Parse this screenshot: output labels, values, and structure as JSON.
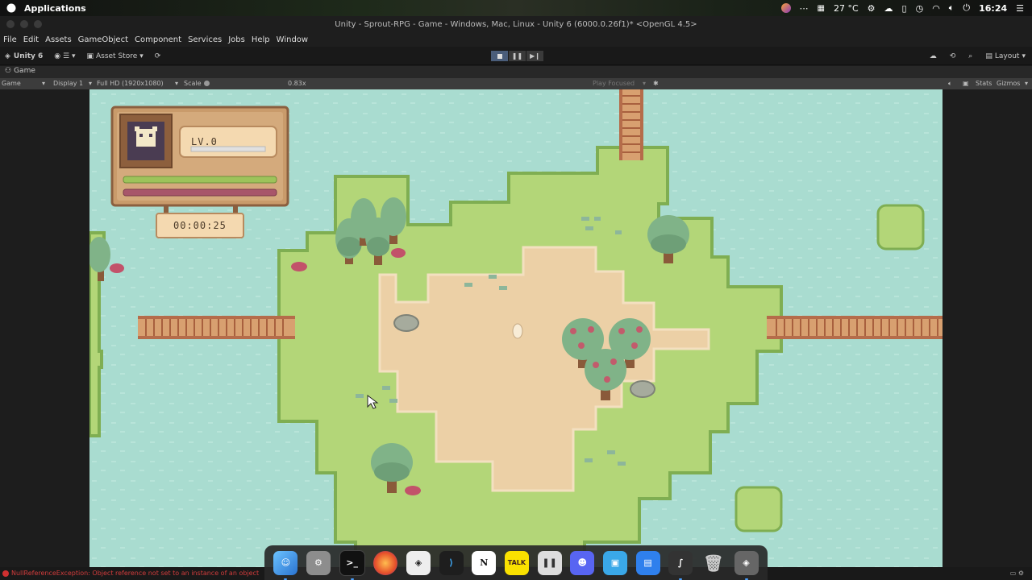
{
  "os_bar": {
    "applications_label": "Applications",
    "temperature": "27 °C",
    "clock": "16:24"
  },
  "window": {
    "title": "Unity - Sprout-RPG - Game - Windows, Mac, Linux - Unity 6 (6000.0.26f1)* <OpenGL 4.5>"
  },
  "menu": [
    "File",
    "Edit",
    "Assets",
    "GameObject",
    "Component",
    "Services",
    "Jobs",
    "Help",
    "Window"
  ],
  "toolbar": {
    "account_label": "Unity 6",
    "asset_store_label": "Asset Store",
    "layout_label": "Layout"
  },
  "game_tab": {
    "label": "Game"
  },
  "game_controls": {
    "view_select": "Game",
    "display_select": "Display 1",
    "resolution_select": "Full HD (1920x1080)",
    "scale_label": "Scale",
    "scale_value": "0.83x",
    "play_mode_select": "Play Focused",
    "stats_label": "Stats",
    "gizmos_label": "Gizmos"
  },
  "hud": {
    "level_text": "LV.0",
    "timer_text": "00:00:25",
    "xp_progress": 0,
    "stamina_progress": 1.0,
    "health_progress": 1.0
  },
  "status_bar": {
    "message": "NullReferenceException: Object reference not set to an instance of an object"
  },
  "dock": {
    "apps": [
      "Finder",
      "System Settings",
      "Terminal",
      "Firefox",
      "Unity Hub",
      "Visual Studio Code",
      "Notion",
      "KakaoTalk",
      "Pixel",
      "Discord",
      "Preview",
      "Files",
      "Figma",
      "Trash",
      "Unity"
    ]
  },
  "colors": {
    "water": "#a9dcd0",
    "grass": "#b3d678",
    "dirt": "#ecd0a6",
    "wood_panel": "#c99b6b",
    "bar_green": "#9dc35a",
    "bar_red": "#a8566a"
  }
}
